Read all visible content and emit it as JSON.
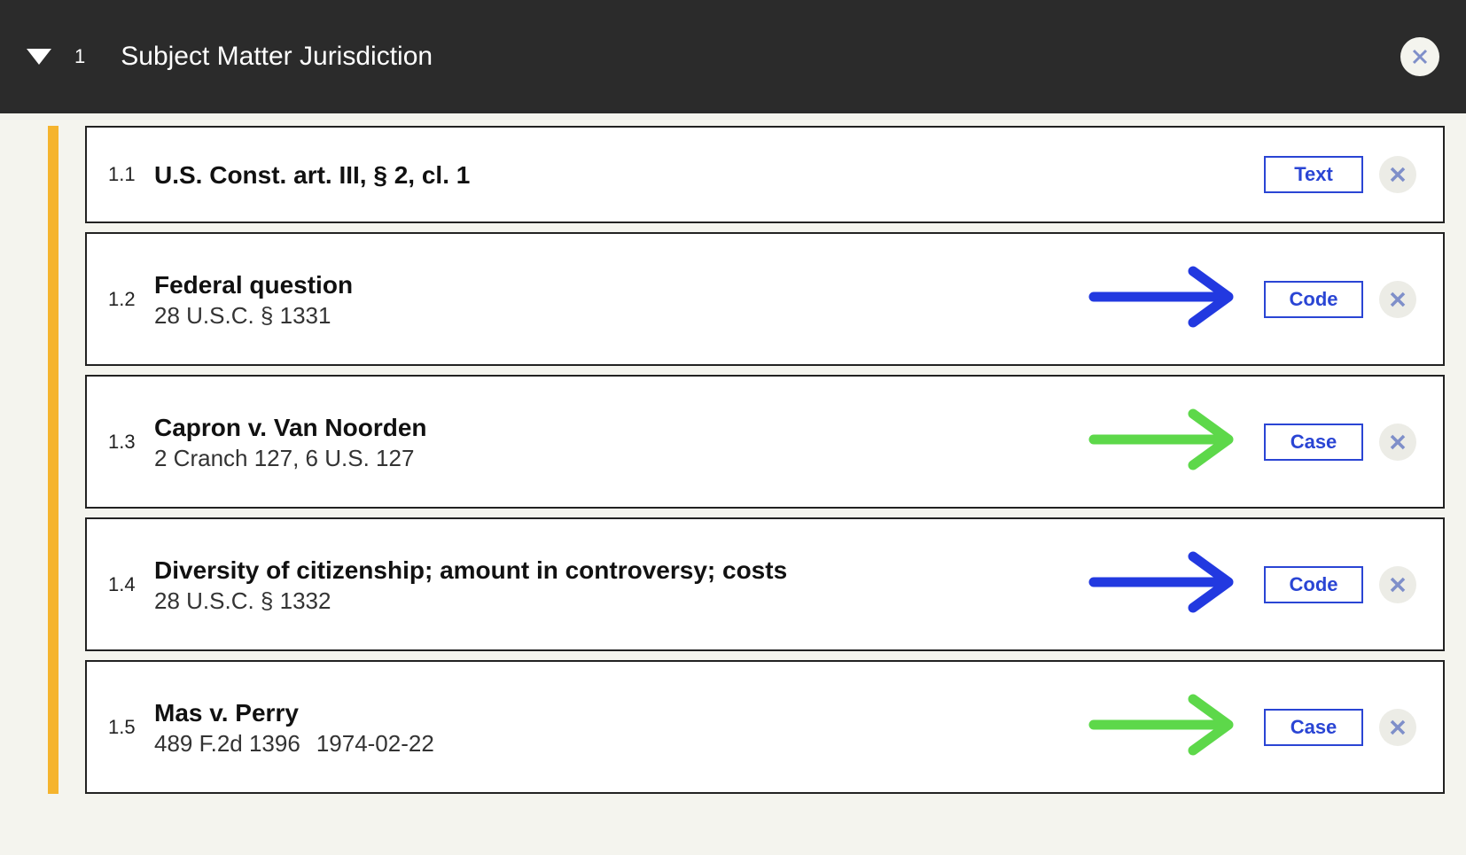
{
  "header": {
    "section_number": "1",
    "section_title": "Subject Matter Jurisdiction"
  },
  "colors": {
    "accent_bar": "#f5b42e",
    "tag_border": "#2a45d4",
    "arrow_blue": "#2239e0",
    "arrow_green": "#5dd84a"
  },
  "items": [
    {
      "num": "1.1",
      "title": "U.S. Const. art. III, § 2, cl. 1",
      "subtitle": "",
      "date": "",
      "tag": "Text",
      "arrow": "none"
    },
    {
      "num": "1.2",
      "title": "Federal question",
      "subtitle": "28 U.S.C. § 1331",
      "date": "",
      "tag": "Code",
      "arrow": "blue"
    },
    {
      "num": "1.3",
      "title": "Capron v. Van Noorden",
      "subtitle": "2 Cranch 127, 6 U.S. 127",
      "date": "",
      "tag": "Case",
      "arrow": "green"
    },
    {
      "num": "1.4",
      "title": "Diversity of citizenship; amount in controversy; costs",
      "subtitle": "28 U.S.C. § 1332",
      "date": "",
      "tag": "Code",
      "arrow": "blue"
    },
    {
      "num": "1.5",
      "title": "Mas v. Perry",
      "subtitle": "489 F.2d 1396",
      "date": "1974-02-22",
      "tag": "Case",
      "arrow": "green"
    }
  ]
}
